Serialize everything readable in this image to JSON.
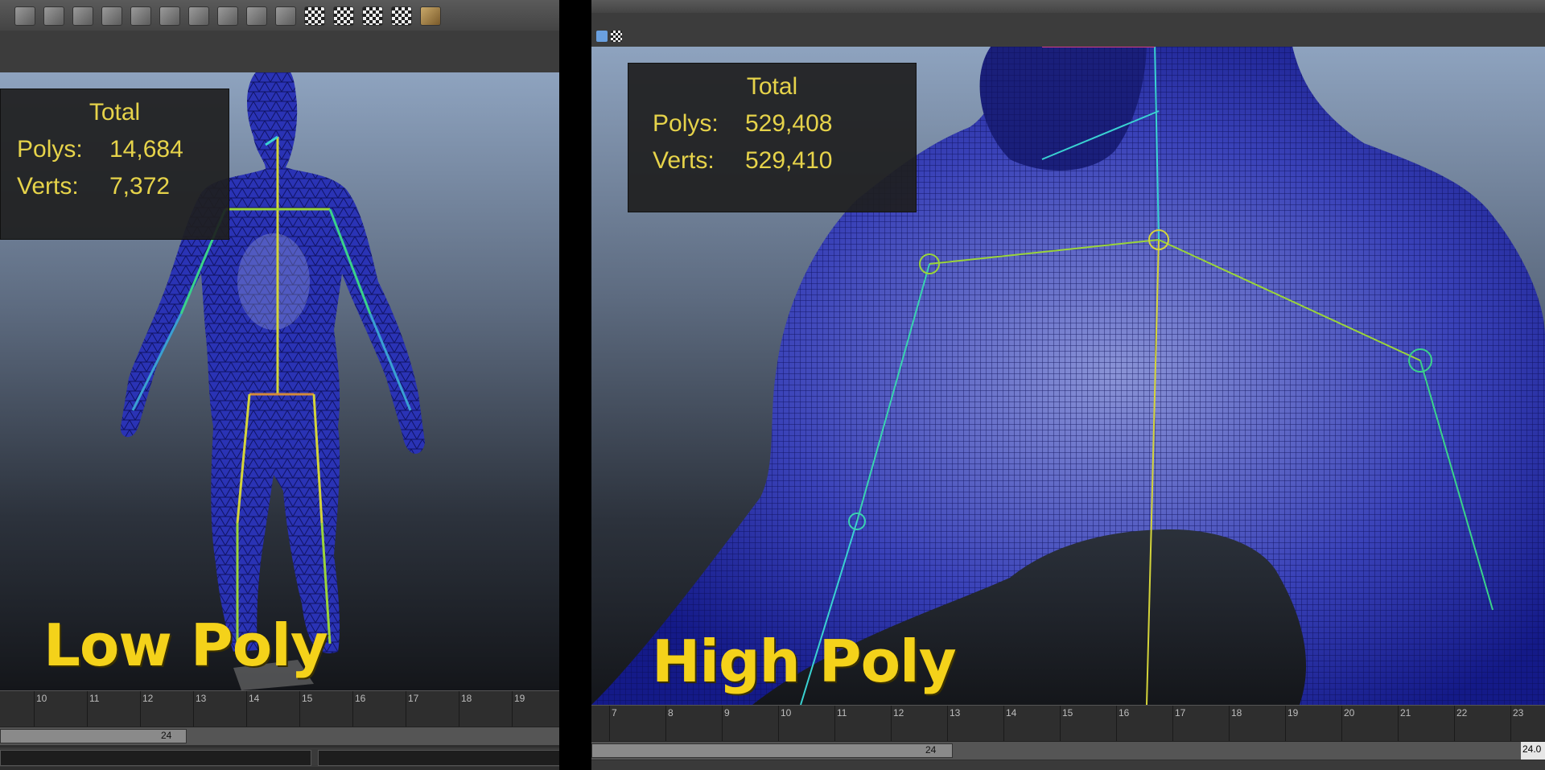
{
  "left": {
    "hud": {
      "title": "Total",
      "polys_label": "Polys:",
      "polys": "14,684",
      "verts_label": "Verts:",
      "verts": "7,372"
    },
    "label": "Low Poly",
    "timeline": {
      "ticks": [
        "10",
        "11",
        "12",
        "13",
        "14",
        "15",
        "16",
        "17",
        "18",
        "19"
      ],
      "range_end": "24"
    }
  },
  "right": {
    "hud": {
      "title": "Total",
      "polys_label": "Polys:",
      "polys": "529,408",
      "verts_label": "Verts:",
      "verts": "529,410"
    },
    "label": "High Poly",
    "timeline": {
      "ticks": [
        "7",
        "8",
        "9",
        "10",
        "11",
        "12",
        "13",
        "14",
        "15",
        "16",
        "17",
        "18",
        "19",
        "20",
        "21",
        "22",
        "23"
      ],
      "range_end": "24",
      "current_frame": "24.0"
    }
  },
  "toolbar_icons": [
    "render-icon",
    "render-icon",
    "ipr-render-icon",
    "settings-icon",
    "hypershade-icon",
    "render-view-icon",
    "render-settings-icon",
    "joint-tool-icon",
    "ik-handle-icon",
    "paint-weights-icon",
    "checker-icon",
    "checker-icon",
    "checker-icon",
    "texture-checker-icon",
    "terrain-icon"
  ],
  "colors": {
    "hud_text": "#e6d34a",
    "label": "#f4d21a",
    "mesh": "#1a1f9a",
    "wire": "#0b0d55",
    "bone_yellow": "#d4d43a",
    "bone_cyan": "#3ad2d2"
  }
}
